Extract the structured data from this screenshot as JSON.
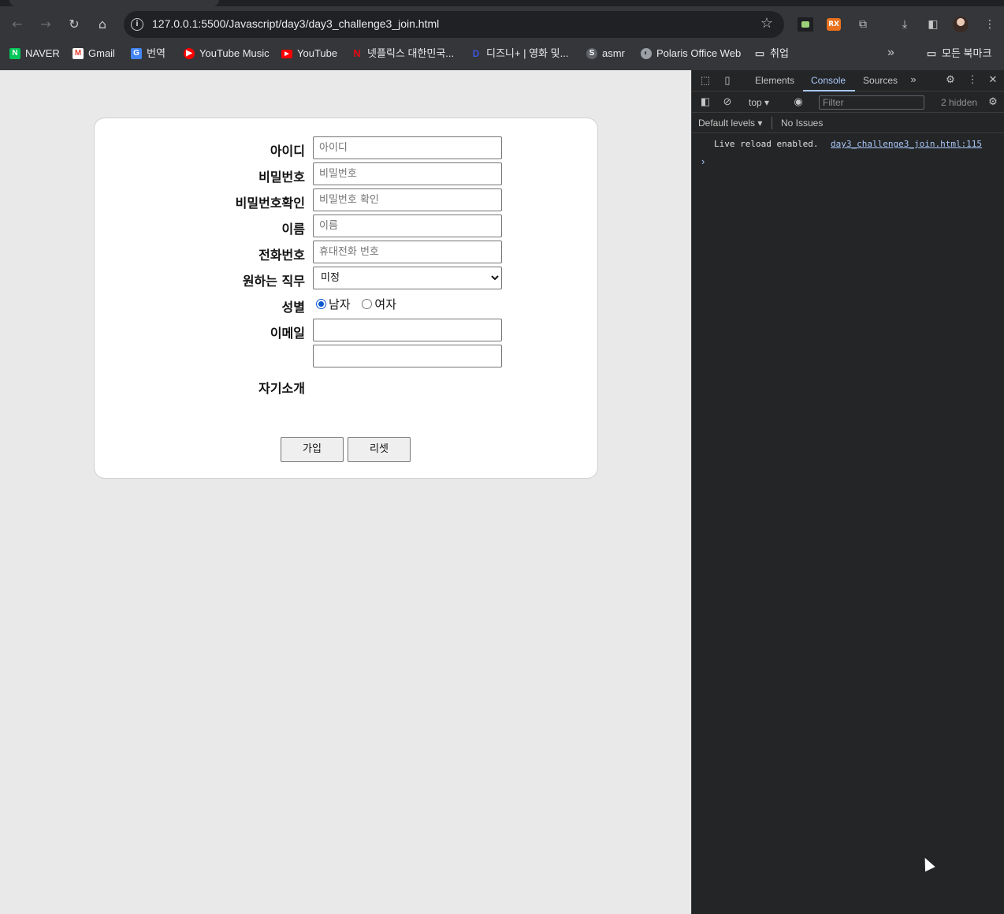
{
  "browser": {
    "url": "127.0.0.1:5500/Javascript/day3/day3_challenge3_join.html",
    "bookmarks": [
      {
        "label": "NAVER",
        "icon": "naver-icon",
        "color": "#03c75a",
        "glyph": "N"
      },
      {
        "label": "Gmail",
        "icon": "gmail-icon",
        "color": "#ea4335",
        "glyph": "M"
      },
      {
        "label": "번역",
        "icon": "translate-icon",
        "color": "#4285f4",
        "glyph": "G"
      },
      {
        "label": "YouTube Music",
        "icon": "youtube-music-icon",
        "color": "#ff0000",
        "glyph": "▶"
      },
      {
        "label": "YouTube",
        "icon": "youtube-icon",
        "color": "#ff0000",
        "glyph": "▶"
      },
      {
        "label": "넷플릭스 대한민국...",
        "icon": "netflix-icon",
        "color": "#e50914",
        "glyph": "N"
      },
      {
        "label": "디즈니+ | 영화 및...",
        "icon": "disney-icon",
        "color": "#1c2fa0",
        "glyph": "D"
      },
      {
        "label": "asmr",
        "icon": "asmr-icon",
        "color": "#5f6368",
        "glyph": "S"
      },
      {
        "label": "Polaris Office Web",
        "icon": "globe-icon",
        "color": "#5f6368",
        "glyph": "◐"
      },
      {
        "label": "취업",
        "icon": "folder-icon",
        "color": "transparent",
        "glyph": "🗀"
      }
    ],
    "all_bookmarks": "모든 북마크"
  },
  "form": {
    "id_label": "아이디",
    "id_placeholder": "아이디",
    "pw_label": "비밀번호",
    "pw_placeholder": "비밀번호",
    "pw2_label": "비밀번호확인",
    "pw2_placeholder": "비밀번호 확인",
    "name_label": "이름",
    "name_placeholder": "이름",
    "phone_label": "전화번호",
    "phone_placeholder": "휴대전화 번호",
    "job_label": "원하는 직무",
    "job_selected": "미정",
    "gender_label": "성별",
    "gender_male": "남자",
    "gender_female": "여자",
    "email_label": "이메일",
    "intro_label": "자기소개",
    "submit": "가입",
    "reset": "리셋"
  },
  "devtools": {
    "tabs": [
      "Elements",
      "Console",
      "Sources"
    ],
    "active_tab": "Console",
    "context": "top",
    "filter_placeholder": "Filter",
    "hidden": "2 hidden",
    "levels": "Default levels",
    "issues": "No Issues",
    "log_message": "Live reload enabled.",
    "log_source": "day3_challenge3_join.html:115"
  }
}
